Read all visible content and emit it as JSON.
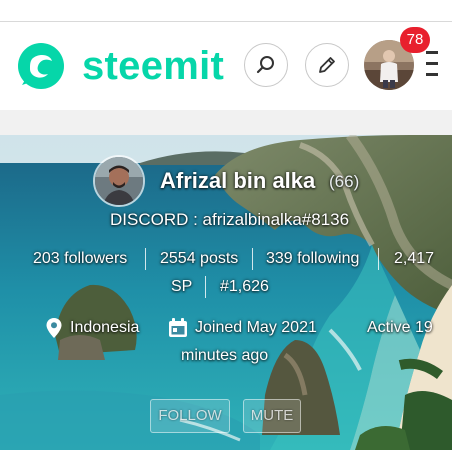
{
  "header": {
    "brand": "steemit",
    "brand_color": "#06d6a9",
    "search_icon": "search-icon",
    "compose_icon": "pencil-icon",
    "notification_count": "78",
    "menu_icon": "hamburger-menu-icon"
  },
  "profile": {
    "name": "Afrizal bin alka",
    "reputation": "(66)",
    "about": "DISCORD : afrizalbinalka#8136",
    "stats": {
      "followers": "203 followers",
      "posts": "2554 posts",
      "following": "339 following",
      "sp_value": "2,417",
      "sp_unit": "SP",
      "rank": "#1,626"
    },
    "location": "Indonesia",
    "joined": "Joined May 2021",
    "active_line1": "Active 19",
    "active_line2": "minutes ago",
    "follow_label": "FOLLOW",
    "mute_label": "MUTE"
  }
}
